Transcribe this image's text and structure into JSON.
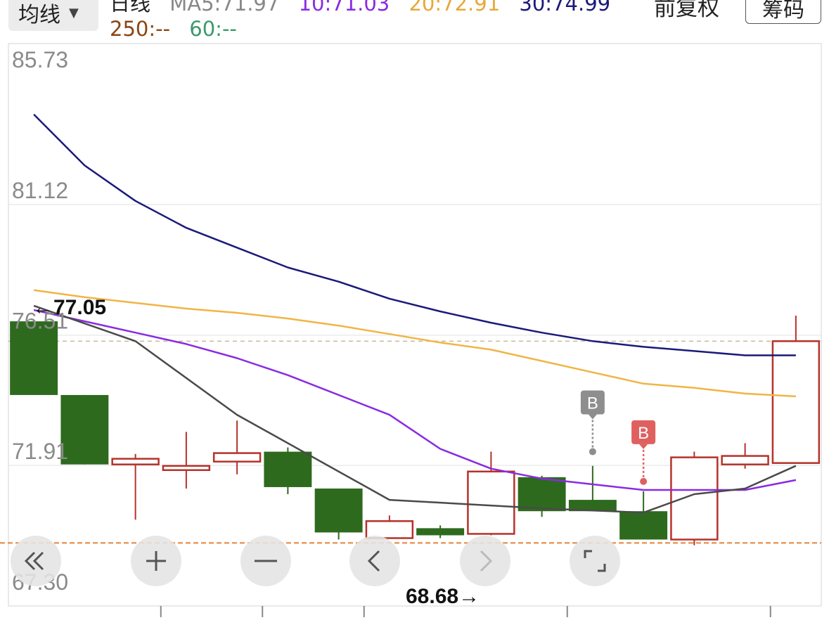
{
  "header": {
    "ma_selector": "均线",
    "period_label": "日线",
    "ma5": "MA5:71.97",
    "ma10": "10:71.03",
    "ma20": "20:72.91",
    "ma30": "30:74.99",
    "ma250": "250:--",
    "ma60": "60:--",
    "adjust_label": "前复权",
    "chips_button": "筹码"
  },
  "colors": {
    "up": "#b5322a",
    "down": "#2e6a1e",
    "ma5": "#4a4a4a",
    "ma10": "#8a2be2",
    "ma20": "#f0b545",
    "ma30": "#1a1a7a",
    "ma250": "#8b4513",
    "ma60": "#3a9a6a",
    "current_price_line": "#c8b89a",
    "low_line": "#e8843a",
    "buy_gray": "#8e8e8e",
    "buy_red": "#e06060"
  },
  "chart_data": {
    "type": "candlestick",
    "y_ticks": [
      "85.73",
      "81.12",
      "76.51",
      "71.91",
      "67.30"
    ],
    "ylim": [
      67.3,
      85.73
    ],
    "high_label": "←77.05",
    "high_value": 77.05,
    "low_label": "68.68→",
    "low_value": 68.68,
    "current_price": 75.8,
    "candles": [
      {
        "open": 76.5,
        "close": 73.9,
        "high": 76.5,
        "low": 73.9
      },
      {
        "open": 73.9,
        "close": 71.45,
        "high": 73.9,
        "low": 71.45
      },
      {
        "open": 71.45,
        "close": 71.65,
        "high": 71.82,
        "low": 69.5
      },
      {
        "open": 71.25,
        "close": 71.4,
        "high": 72.6,
        "low": 70.6
      },
      {
        "open": 71.55,
        "close": 71.85,
        "high": 73.0,
        "low": 71.1
      },
      {
        "open": 71.9,
        "close": 70.65,
        "high": 72.05,
        "low": 70.4
      },
      {
        "open": 70.6,
        "close": 69.05,
        "high": 70.6,
        "low": 68.8
      },
      {
        "open": 68.85,
        "close": 69.45,
        "high": 69.65,
        "low": 68.85
      },
      {
        "open": 69.2,
        "close": 68.95,
        "high": 69.3,
        "low": 68.85
      },
      {
        "open": 69.0,
        "close": 71.2,
        "high": 71.9,
        "low": 68.95
      },
      {
        "open": 71.0,
        "close": 69.8,
        "high": 71.05,
        "low": 69.6
      },
      {
        "open": 70.2,
        "close": 69.8,
        "high": 71.4,
        "low": 69.8
      },
      {
        "open": 69.8,
        "close": 68.8,
        "high": 70.5,
        "low": 68.8
      },
      {
        "open": 68.8,
        "close": 71.7,
        "high": 71.9,
        "low": 68.6
      },
      {
        "open": 71.45,
        "close": 71.75,
        "high": 72.2,
        "low": 71.3
      },
      {
        "open": 71.5,
        "close": 75.8,
        "high": 76.7,
        "low": 71.5
      }
    ],
    "ma5": [
      77.05,
      null,
      75.8,
      null,
      73.2,
      null,
      null,
      70.2,
      null,
      null,
      69.9,
      null,
      69.75,
      70.4,
      70.6,
      71.4
    ],
    "ma10": [
      76.9,
      null,
      76.1,
      75.7,
      75.2,
      74.6,
      null,
      73.2,
      72.0,
      71.3,
      70.95,
      null,
      70.55,
      70.55,
      70.55,
      70.9
    ],
    "ma20": [
      77.6,
      77.35,
      77.15,
      76.95,
      76.8,
      76.6,
      76.35,
      76.05,
      75.75,
      75.5,
      75.1,
      74.7,
      74.3,
      74.15,
      73.95,
      73.85
    ],
    "ma30": [
      83.8,
      82.0,
      80.75,
      79.8,
      79.1,
      78.4,
      77.9,
      77.3,
      76.85,
      76.45,
      76.1,
      75.8,
      75.6,
      75.45,
      75.3,
      75.3
    ],
    "markers": [
      {
        "index": 11,
        "label": "B",
        "color": "gray",
        "price": 71.9
      },
      {
        "index": 12,
        "label": "B",
        "color": "red",
        "price": 70.85
      }
    ]
  },
  "axis_ticks_x": [
    3,
    5,
    7,
    11,
    15
  ]
}
